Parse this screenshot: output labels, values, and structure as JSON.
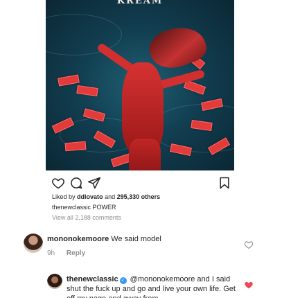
{
  "post": {
    "image_title": "KREAM",
    "likes_text": "Liked by",
    "liked_by_user": "ddlovato",
    "likes_connector": "and",
    "likes_count": "295,330 others",
    "caption_user": "thenewclassic",
    "caption_text": "POWER",
    "view_all_comments": "View all 2,188 comments"
  },
  "comments": [
    {
      "username": "mononokemoore",
      "text": "We said model",
      "time": "9h",
      "reply_label": "Reply",
      "liked": false
    },
    {
      "username": "thenewclassic",
      "text": "@mononokemoore and I said shut the fuck up and go and live your own life. Get off my page and away from",
      "verified": true,
      "liked": true
    }
  ],
  "icons": {
    "like": "heart-icon",
    "comment": "comment-icon",
    "share": "paper-plane-icon",
    "save": "bookmark-icon",
    "verified": "verified-badge-icon",
    "comment_like": "heart-icon"
  },
  "colors": {
    "liked_heart": "#ed4956",
    "verified": "#3897f0",
    "muted_text": "#8e8e8e"
  }
}
